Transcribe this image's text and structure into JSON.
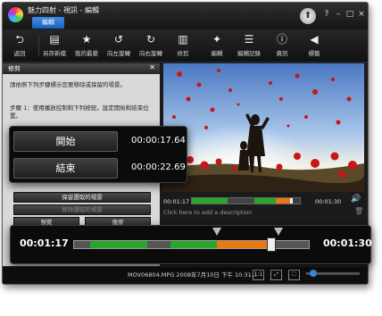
{
  "window": {
    "title": "魅力四射 - 視訊 - 編輯",
    "active_tab": "編輯",
    "upgrade_icon": "arrow-up-icon",
    "controls": [
      "?",
      "–",
      "□",
      "×"
    ]
  },
  "toolbar": {
    "items": [
      {
        "label": "返回",
        "icon": "back-arrow-icon",
        "glyph": "⮌"
      },
      {
        "label": "另存新檔",
        "icon": "save-as-icon",
        "glyph": "▤"
      },
      {
        "label": "我的最愛",
        "icon": "star-icon",
        "glyph": "★"
      },
      {
        "label": "向左旋轉",
        "icon": "rotate-left-icon",
        "glyph": "↺"
      },
      {
        "label": "向右旋轉",
        "icon": "rotate-right-icon",
        "glyph": "↻"
      },
      {
        "label": "修剪",
        "icon": "trim-icon",
        "glyph": "▥"
      },
      {
        "label": "編輯",
        "icon": "magic-wand-icon",
        "glyph": "✦"
      },
      {
        "label": "編輯記錄",
        "icon": "edit-history-icon",
        "glyph": "☰"
      },
      {
        "label": "資訊",
        "icon": "info-icon",
        "glyph": "ⓘ"
      },
      {
        "label": "標籤",
        "icon": "tag-icon",
        "glyph": "◀"
      }
    ]
  },
  "trim_panel": {
    "title": "修剪",
    "instruction": "請依照下列步驟標示您要移除或保留的場景。",
    "step1": "步驟 1：使用播放控制和下列按鈕，設定開始和結束位置。",
    "start_label": "開始",
    "start_time": "00:00:17.64",
    "end_label": "結束",
    "end_time": "00:00:22.69",
    "keep_selected": "保留選取的場景",
    "remove_selected": "移除選取的場景",
    "preview": "預覽",
    "undo": "復原"
  },
  "player": {
    "current_time": "00:01:17",
    "total_time": "00:01:30",
    "description_placeholder": "Click here to add a description",
    "volume_icon": "speaker-icon",
    "delete_icon": "trash-icon"
  },
  "zoom_timeline": {
    "current_time": "00:01:17",
    "total_time": "00:01:30"
  },
  "status": {
    "file_info": "MOV06804.MPG 2008年7月10日 下午 10:31...",
    "ratio_label": "1:1"
  },
  "colors": {
    "accent_blue": "#2f7fe0",
    "keep_green": "#2aa52a",
    "cut_orange": "#e8780f"
  }
}
